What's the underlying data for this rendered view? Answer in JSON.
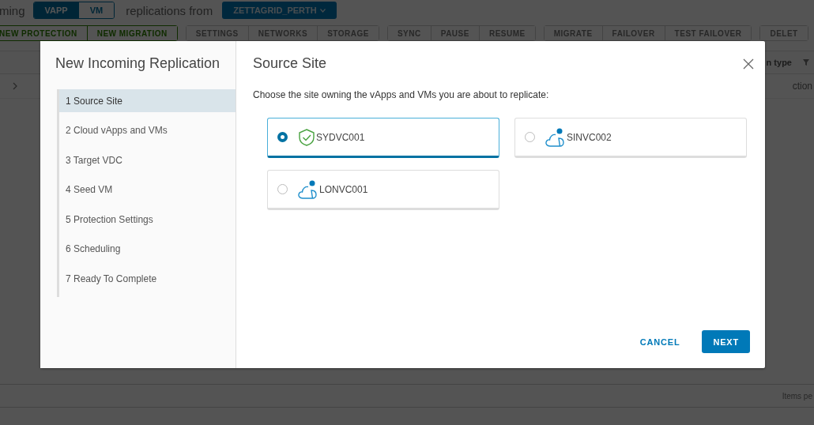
{
  "background": {
    "view_label": "ming",
    "type_toggle": [
      {
        "label": "VAPP",
        "selected": true
      },
      {
        "label": "VM",
        "selected": false
      }
    ],
    "from_label": "replications from",
    "site_dropdown": "ZETTAGRID_PERTH",
    "toolbar": [
      [
        {
          "label": "NEW PROTECTION",
          "disabled": false
        },
        {
          "label": "NEW MIGRATION",
          "disabled": false
        }
      ],
      [
        {
          "label": "SETTINGS",
          "disabled": true
        },
        {
          "label": "NETWORKS",
          "disabled": true
        },
        {
          "label": "STORAGE",
          "disabled": true
        }
      ],
      [
        {
          "label": "SYNC",
          "disabled": true
        },
        {
          "label": "PAUSE",
          "disabled": true
        },
        {
          "label": "RESUME",
          "disabled": true
        }
      ],
      [
        {
          "label": "MIGRATE",
          "disabled": true
        },
        {
          "label": "FAILOVER",
          "disabled": true
        },
        {
          "label": "TEST FAILOVER",
          "disabled": true
        }
      ],
      [
        {
          "label": "DELET",
          "disabled": true
        }
      ]
    ],
    "column_header": "n type",
    "row_cell": "ction",
    "footer": "Items pe"
  },
  "dialog": {
    "title": "New Incoming Replication",
    "steps": [
      {
        "label": "1 Source Site",
        "selected": true
      },
      {
        "label": "2 Cloud vApps and VMs",
        "selected": false
      },
      {
        "label": "3 Target VDC",
        "selected": false
      },
      {
        "label": "4 Seed VM",
        "selected": false
      },
      {
        "label": "5 Protection Settings",
        "selected": false
      },
      {
        "label": "6 Scheduling",
        "selected": false
      },
      {
        "label": "7 Ready To Complete",
        "selected": false
      }
    ],
    "page_title": "Source Site",
    "instruction": "Choose the site owning the vApps and VMs you are about to replicate:",
    "sites": [
      {
        "name": "SYDVC001",
        "kind": "shield",
        "selected": true
      },
      {
        "name": "SINVC002",
        "kind": "cloud",
        "selected": false
      },
      {
        "name": "LONVC001",
        "kind": "cloud",
        "selected": false
      }
    ],
    "buttons": [
      {
        "label": "CANCEL",
        "kind": "flat"
      },
      {
        "label": "NEXT",
        "kind": "primary"
      }
    ]
  }
}
